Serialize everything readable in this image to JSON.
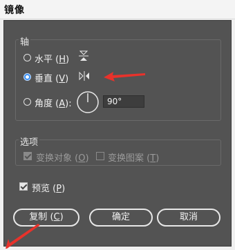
{
  "dialog": {
    "title": "镜像"
  },
  "axis": {
    "group_title": "轴",
    "options": [
      {
        "label": "水平",
        "key": "H",
        "checked": false,
        "icon": "flip-horizontal-axis-icon"
      },
      {
        "label": "垂直",
        "key": "V",
        "checked": true,
        "icon": "flip-vertical-axis-icon"
      },
      {
        "label": "角度",
        "key": "A",
        "checked": false,
        "icon": "angle-dial-icon"
      }
    ],
    "angle_value": "90°"
  },
  "options_group": {
    "title": "选项",
    "transform_objects": {
      "label": "变换对象",
      "key": "O",
      "checked": true,
      "enabled": false
    },
    "transform_patterns": {
      "label": "变换图案",
      "key": "T",
      "checked": false,
      "enabled": false
    }
  },
  "preview": {
    "label": "预览",
    "key": "P",
    "checked": true
  },
  "buttons": {
    "copy": {
      "label": "复制",
      "key": "C"
    },
    "ok": {
      "label": "确定"
    },
    "cancel": {
      "label": "取消"
    }
  },
  "colors": {
    "panel": "#535353",
    "accent": "#3b8ff0",
    "arrow": "#e8322b"
  }
}
